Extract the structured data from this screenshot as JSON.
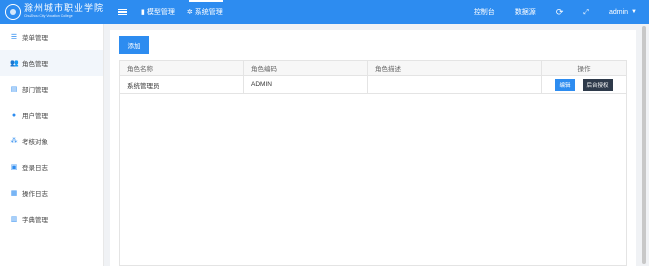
{
  "header": {
    "logo_cn": "滁州城市职业学院",
    "logo_en": "ChuZhou City Vocation College",
    "nav": [
      {
        "label": "模型管理",
        "icon": "database-icon"
      },
      {
        "label": "系统管理",
        "icon": "gears-icon",
        "active": true
      }
    ],
    "right_links": [
      "控制台",
      "数据源"
    ],
    "user": "admin",
    "colors": {
      "primary": "#2d8cf0"
    }
  },
  "sidebar": {
    "items": [
      {
        "label": "菜单管理",
        "icon": "list-icon"
      },
      {
        "label": "角色管理",
        "icon": "users-icon",
        "active": true
      },
      {
        "label": "部门管理",
        "icon": "building-icon"
      },
      {
        "label": "用户管理",
        "icon": "user-group-icon"
      },
      {
        "label": "考核对象",
        "icon": "sitemap-icon"
      },
      {
        "label": "登录日志",
        "icon": "login-log-icon"
      },
      {
        "label": "操作日志",
        "icon": "operation-log-icon"
      },
      {
        "label": "字典管理",
        "icon": "dictionary-icon"
      }
    ]
  },
  "main": {
    "add_label": "添加",
    "columns": [
      "角色名称",
      "角色编码",
      "角色描述",
      "操作"
    ],
    "rows": [
      {
        "name": "系统管理员",
        "code": "ADMIN",
        "desc": "",
        "edit": "编辑",
        "auth": "后台授权"
      }
    ]
  }
}
